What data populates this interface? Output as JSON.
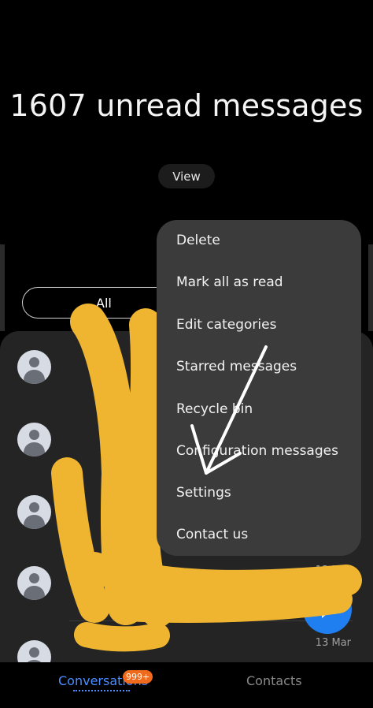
{
  "header": {
    "title": "1607 unread messages",
    "view_label": "View"
  },
  "filter": {
    "all_label": "All"
  },
  "conversations": [
    {
      "snippet": "",
      "date": ""
    },
    {
      "snippet": "",
      "date": ""
    },
    {
      "snippet": "",
      "date": ""
    },
    {
      "snippet": "",
      "date": "13 Mar"
    },
    {
      "snippet": "",
      "date": "13 Mar"
    }
  ],
  "menu": {
    "items": [
      "Delete",
      "Mark all as read",
      "Edit categories",
      "Starred messages",
      "Recycle bin",
      "Configuration messages",
      "Settings",
      "Contact us"
    ]
  },
  "bottom_nav": {
    "conversations_label": "Conversations",
    "badge": "999+",
    "contacts_label": "Contacts"
  },
  "colors": {
    "accent": "#1f7ef0",
    "badge": "#f06a1c",
    "scribble": "#f0b530",
    "arrow": "#ffffff"
  }
}
